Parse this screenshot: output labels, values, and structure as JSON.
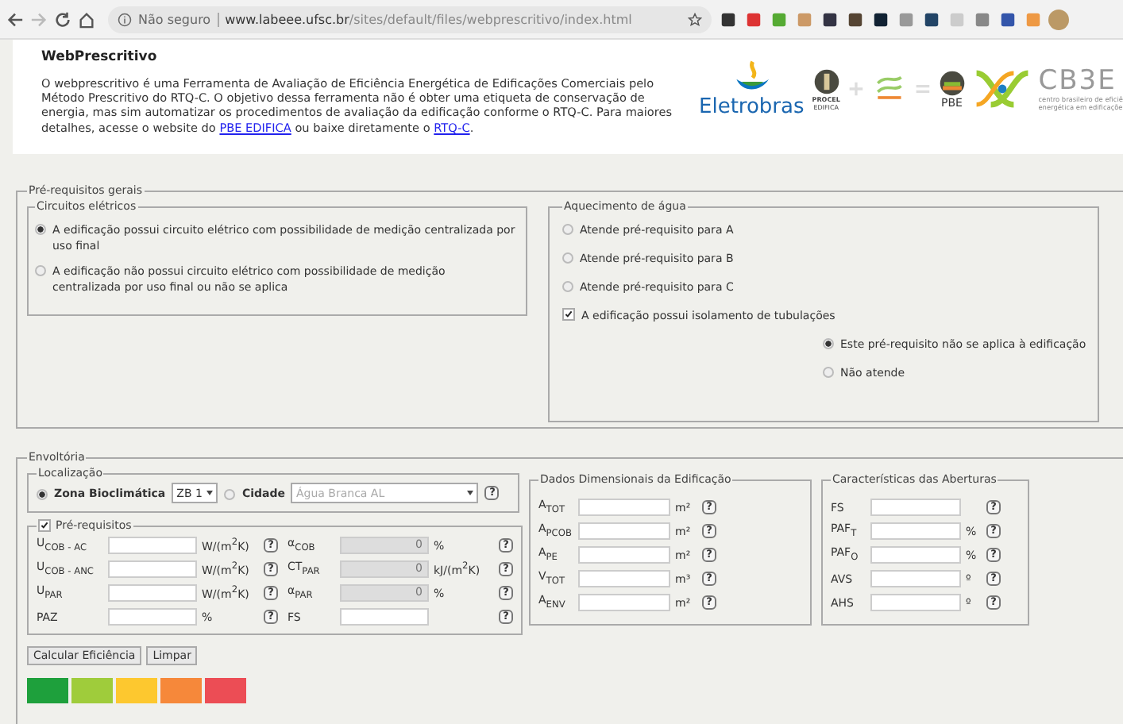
{
  "browser": {
    "security_label": "Não seguro",
    "url_host": "www.labeee.ufsc.br",
    "url_path": "/sites/default/files/webprescritivo/index.html"
  },
  "header": {
    "title": "WebPrescritivo",
    "description": {
      "text_before": "O webprescritivo é uma Ferramenta de Avaliação de Eficiência Energética de Edificações Comerciais pelo Método Prescritivo do RTQ-C. O objetivo dessa ferramenta não é obter uma etiqueta de conservação de energia, mas sim automatizar os procedimentos de avaliação da edificação conforme o RTQ-C. Para maiores detalhes, acesse o website do ",
      "link_1": "PBE EDIFICA",
      "text_middle": " ou baixe diretamente o ",
      "link_2": "RTQ-C",
      "text_after": "."
    },
    "logos": {
      "eletrobras": "Eletrobras",
      "procel": "PROCEL",
      "edifica": "EDIFICA",
      "pbe": "PBE",
      "cb3e": "CB3E",
      "cb3e_line1": "centro brasileiro de eficiê",
      "cb3e_line2": "energética em edificaçõe"
    }
  },
  "general": {
    "legend": "Pré-requisitos gerais",
    "circuits": {
      "legend": "Circuitos elétricos",
      "options": [
        {
          "label": "A edificação possui circuito elétrico com possibilidade de medição centralizada por uso final",
          "selected": true
        },
        {
          "label": "A edificação não possui circuito elétrico com possibilidade de medição centralizada por uso final ou não se aplica",
          "selected": false
        }
      ]
    },
    "water": {
      "legend": "Aquecimento de água",
      "options": [
        {
          "label": "Atende pré-requisito para A",
          "selected": false
        },
        {
          "label": "Atende pré-requisito para B",
          "selected": false
        },
        {
          "label": "Atende pré-requisito para C",
          "selected": false
        }
      ],
      "insulation": {
        "label": "A edificação possui isolamento de tubulações",
        "checked": true
      },
      "sub_options": [
        {
          "label": "Este pré-requisito não se aplica à edificação",
          "selected": true
        },
        {
          "label": "Não atende",
          "selected": false
        }
      ]
    }
  },
  "envelope": {
    "legend": "Envoltória",
    "location": {
      "legend": "Localização",
      "zone": {
        "label": "Zona Bioclimática",
        "selected": true,
        "value": "ZB 1"
      },
      "city": {
        "label": "Cidade",
        "selected": false,
        "value": "Água Branca AL",
        "disabled": true
      },
      "help": "?"
    },
    "prereq": {
      "legend": "Pré-requisitos",
      "checked": true,
      "rows": [
        {
          "label": "U$_{COB - AC}$",
          "unit": "W/(m$^{2}$K)",
          "help": "?",
          "label2": "α$_{COB}$",
          "value2": "0",
          "unit2": "%",
          "help2": "?",
          "disabled2": true
        },
        {
          "label": "U$_{COB - ANC}$",
          "unit": "W/(m$^{2}$K)",
          "help": "?",
          "label2": "CT$_{PAR}$",
          "value2": "0",
          "unit2": "kJ/(m$^{2}$K)",
          "help2": "?",
          "disabled2": true
        },
        {
          "label": "U$_{PAR}$",
          "unit": "W/(m$^{2}$K)",
          "help": "?",
          "label2": "α$_{PAR}$",
          "value2": "0",
          "unit2": "%",
          "help2": "?",
          "disabled2": true
        },
        {
          "label": "PAZ",
          "unit": "%",
          "help": "?",
          "label2": "FS",
          "help2": "?",
          "disabled2": false
        }
      ]
    },
    "dimensions": {
      "legend": "Dados Dimensionais da Edificação",
      "rows": [
        {
          "label": "A$_{TOT}$",
          "unit": "m²",
          "help": "?"
        },
        {
          "label": "A$_{PCOB}$",
          "unit": "m²",
          "help": "?"
        },
        {
          "label": "A$_{PE}$",
          "unit": "m²",
          "help": "?"
        },
        {
          "label": "V$_{TOT}$",
          "unit": "m³",
          "help": "?"
        },
        {
          "label": "A$_{ENV}$",
          "unit": "m²",
          "help": "?"
        }
      ]
    },
    "apertures": {
      "legend": "Características das Aberturas",
      "rows": [
        {
          "label": "FS",
          "help": "?"
        },
        {
          "label": "PAF$_{T}$",
          "unit": "%",
          "help": "?"
        },
        {
          "label": "PAF$_{O}$",
          "unit": "%",
          "help": "?"
        },
        {
          "label": "AVS",
          "unit": "º",
          "help": "?"
        },
        {
          "label": "AHS",
          "unit": "º",
          "help": "?"
        }
      ]
    }
  },
  "buttons": [
    "Calcular Eficiência",
    "Limpar"
  ],
  "scale": [
    {
      "color": "#1ea03c"
    },
    {
      "color": "#9fcc3b"
    },
    {
      "color": "#fdc82f"
    },
    {
      "color": "#f6883a"
    },
    {
      "color": "#ec4d55"
    }
  ]
}
